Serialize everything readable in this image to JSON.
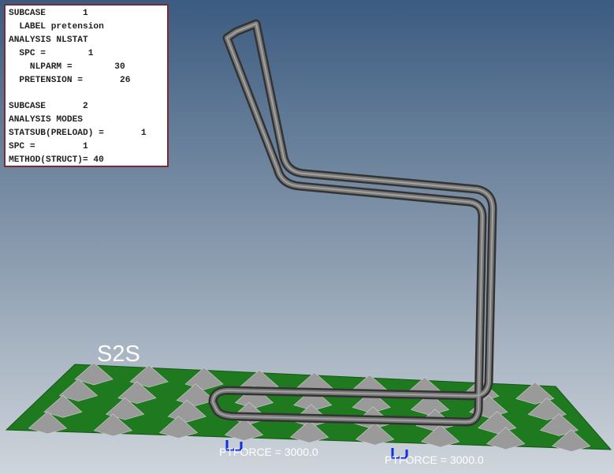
{
  "card": {
    "lines": [
      "SUBCASE       1",
      "  LABEL pretension",
      "ANALYSIS NLSTAT",
      "  SPC =        1",
      "    NLPARM =        30",
      "  PRETENSION =       26",
      "",
      "SUBCASE       2",
      "ANALYSIS MODES",
      "STATSUB(PRELOAD) =       1",
      "SPC =         1",
      "METHOD(STRUCT)= 40"
    ]
  },
  "labels": {
    "contact": "S2S",
    "force1": "PTFORCE = 3000.0",
    "force2": "PTFORCE = 3000.0"
  },
  "colors": {
    "bg_top": "#3b5b80",
    "bg_bottom": "#cdd4dc",
    "plate": "#1f7a1f",
    "tube": "#6e6e6e"
  }
}
